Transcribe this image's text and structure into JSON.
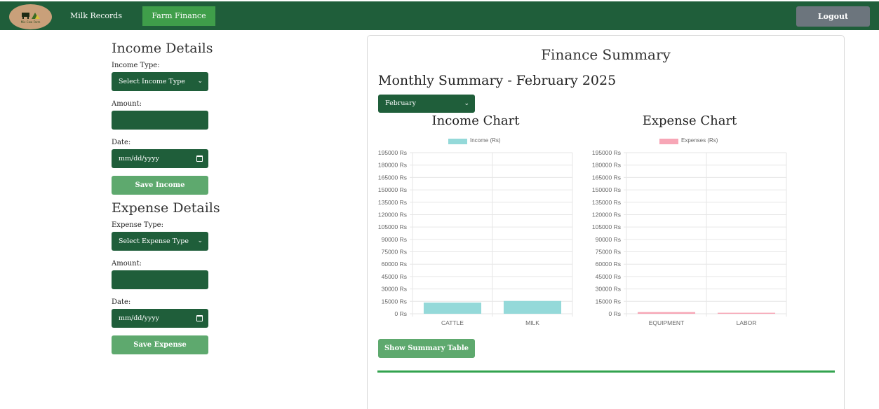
{
  "nav": {
    "logo_text": "Mix Cow Farm",
    "milk_records": "Milk Records",
    "farm_finance": "Farm Finance",
    "logout": "Logout"
  },
  "income_form": {
    "title": "Income Details",
    "type_label": "Income Type:",
    "type_value": "Select Income Type",
    "amount_label": "Amount:",
    "amount_value": "",
    "date_label": "Date:",
    "date_placeholder": "mm/dd/yyyy",
    "save_label": "Save Income"
  },
  "expense_form": {
    "title": "Expense Details",
    "type_label": "Expense Type:",
    "type_value": "Select Expense Type",
    "amount_label": "Amount:",
    "amount_value": "",
    "date_label": "Date:",
    "date_placeholder": "mm/dd/yyyy",
    "save_label": "Save Expense"
  },
  "summary": {
    "title": "Finance Summary",
    "month_title": "Monthly Summary - February 2025",
    "month_select": "February",
    "show_table_label": "Show Summary Table"
  },
  "chart_data": [
    {
      "type": "bar",
      "title": "Income Chart",
      "categories": [
        "CATTLE",
        "MILK"
      ],
      "series": [
        {
          "name": "Income (Rs)",
          "values": [
            13500,
            15500
          ]
        }
      ],
      "ylim": [
        0,
        195000
      ],
      "yticks": [
        "195000 Rs",
        "180000 Rs",
        "165000 Rs",
        "150000 Rs",
        "135000 Rs",
        "120000 Rs",
        "105000 Rs",
        "90000 Rs",
        "75000 Rs",
        "60000 Rs",
        "45000 Rs",
        "30000 Rs",
        "15000 Rs",
        "0 Rs"
      ],
      "color": "#94d9d9",
      "legend": "top",
      "grid": true
    },
    {
      "type": "bar",
      "title": "Expense Chart",
      "categories": [
        "EQUIPMENT",
        "LABOR"
      ],
      "series": [
        {
          "name": "Expenses (Rs)",
          "values": [
            2000,
            1200
          ]
        }
      ],
      "ylim": [
        0,
        195000
      ],
      "yticks": [
        "195000 Rs",
        "180000 Rs",
        "165000 Rs",
        "150000 Rs",
        "135000 Rs",
        "120000 Rs",
        "105000 Rs",
        "90000 Rs",
        "75000 Rs",
        "60000 Rs",
        "45000 Rs",
        "30000 Rs",
        "15000 Rs",
        "0 Rs"
      ],
      "color": "#f7a6b6",
      "legend": "top",
      "grid": true
    }
  ]
}
